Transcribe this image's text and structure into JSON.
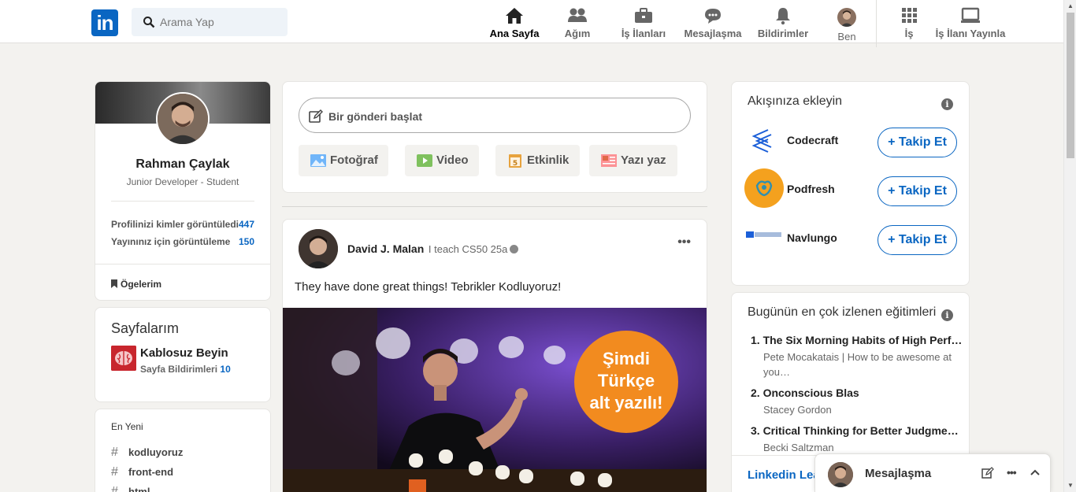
{
  "header": {
    "search_placeholder": "Arama Yap",
    "nav": [
      {
        "label": "Ana Sayfa"
      },
      {
        "label": "Ağım"
      },
      {
        "label": "İş İlanları"
      },
      {
        "label": "Mesajlaşma"
      },
      {
        "label": "Bildirimler"
      },
      {
        "label": "Ben"
      },
      {
        "label": "İş"
      },
      {
        "label": "İş İlanı Yayınla"
      }
    ]
  },
  "profile": {
    "name": "Rahman Çaylak",
    "title": "Junior Developer - Student",
    "stats": [
      {
        "label": "Profilinizi kimler görüntüledi",
        "value": "447"
      },
      {
        "label": "Yayınınız için görüntüleme",
        "value": "150"
      }
    ],
    "items_label": "Ögelerim"
  },
  "pages": {
    "title": "Sayfalarım",
    "page_name": "Kablosuz Beyin",
    "notif_label": "Sayfa Bildirimleri",
    "notif_count": "10"
  },
  "recent": {
    "title": "En Yeni",
    "tags": [
      "kodluyoruz",
      "front-end",
      "html"
    ]
  },
  "composer": {
    "placeholder": "Bir gönderi başlat",
    "actions": [
      "Fotoğraf",
      "Video",
      "Etkinlik",
      "Yazı yaz"
    ]
  },
  "post": {
    "author": "David J. Malan",
    "meta": "I teach CS50 25a",
    "text": "They have done great things! Tebrikler Kodluyoruz!",
    "image_badge": [
      "Şimdi",
      "Türkçe",
      "alt yazılı!"
    ]
  },
  "follow": {
    "title": "Akışınıza ekleyin",
    "suggestions": [
      {
        "name": "Codecraft",
        "button": "+ Takip Et"
      },
      {
        "name": "Podfresh",
        "button": "+ Takip Et"
      },
      {
        "name": "Navlungo",
        "button": "+ Takip Et"
      }
    ]
  },
  "courses": {
    "title": "Bugünün en çok izlenen eğitimleri",
    "list": [
      {
        "title": "1. The Six Morning Habits of High Perf…",
        "author": "Pete Mocakatais | How to be awesome at you…"
      },
      {
        "title": "2. Onconscious Blas",
        "author": "Stacey Gordon"
      },
      {
        "title": "3. Critical Thinking for Better Judgme…",
        "author": "Becki Saltzman"
      }
    ],
    "link": "Linkedin Lea… göster"
  },
  "messaging": {
    "label": "Mesajlaşma"
  }
}
